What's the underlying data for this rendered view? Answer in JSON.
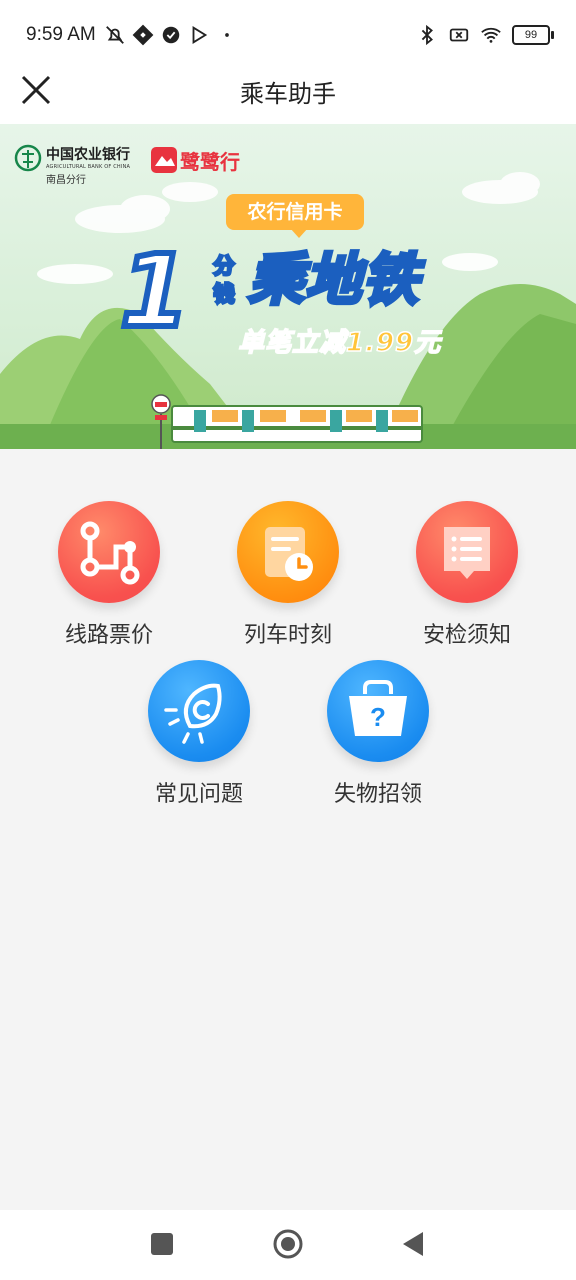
{
  "status_bar": {
    "time": "9:59 AM",
    "battery": "99",
    "left_icons": [
      "mute-icon",
      "signal-app-icon",
      "check-circle-icon",
      "play-store-icon",
      "dot-icon"
    ],
    "right_icons": [
      "bluetooth-icon",
      "sim-off-icon",
      "wifi-icon",
      "battery-icon"
    ]
  },
  "header": {
    "title": "乘车助手",
    "close_icon": "close-icon"
  },
  "banner": {
    "bank_name": "中国农业银行",
    "bank_name_en": "AGRICULTURAL BANK OF CHINA",
    "bank_branch": "南昌分行",
    "partner_brand": "鹭鹭行",
    "promo_tag": "农行信用卡",
    "big_number": "1",
    "unit": "分钱",
    "headline": "乘地铁",
    "sub_headline": "单笔立减1.99元"
  },
  "tools": [
    {
      "label": "线路票价",
      "icon": "route-icon",
      "color": "#f8514e"
    },
    {
      "label": "列车时刻",
      "icon": "schedule-icon",
      "color": "#ff8f10"
    },
    {
      "label": "安检须知",
      "icon": "notice-icon",
      "color": "#f8514e"
    },
    {
      "label": "常见问题",
      "icon": "faq-icon",
      "color": "#1a8cf0"
    },
    {
      "label": "失物招领",
      "icon": "lost-found-icon",
      "color": "#1a8cf0"
    }
  ],
  "nav": {
    "icons": [
      "recent-apps-icon",
      "home-icon",
      "back-icon"
    ]
  }
}
